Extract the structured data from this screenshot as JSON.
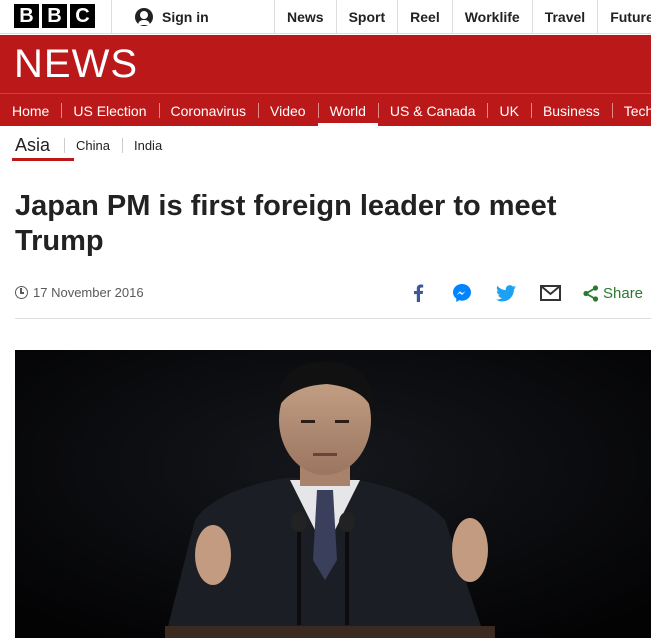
{
  "brand": {
    "logo_letters": [
      "B",
      "B",
      "C"
    ]
  },
  "topbar": {
    "signin_label": "Sign in",
    "nav": [
      "News",
      "Sport",
      "Reel",
      "Worklife",
      "Travel",
      "Future"
    ]
  },
  "banner": {
    "title": "NEWS"
  },
  "section_nav": {
    "items": [
      "Home",
      "US Election",
      "Coronavirus",
      "Video",
      "World",
      "US & Canada",
      "UK",
      "Business",
      "Tech"
    ],
    "active": "World"
  },
  "sub_nav": {
    "current": "Asia",
    "items": [
      "China",
      "India"
    ]
  },
  "article": {
    "headline": "Japan PM is first foreign leader to meet Trump",
    "date": "17 November 2016",
    "share_label": "Share",
    "share_icons": [
      "facebook-icon",
      "messenger-icon",
      "twitter-icon",
      "email-icon",
      "share-icon"
    ]
  },
  "colors": {
    "brand_red": "#bb1919",
    "facebook": "#3b5998",
    "messenger": "#0084ff",
    "twitter": "#1da1f2",
    "share_green": "#2a7a2f"
  }
}
